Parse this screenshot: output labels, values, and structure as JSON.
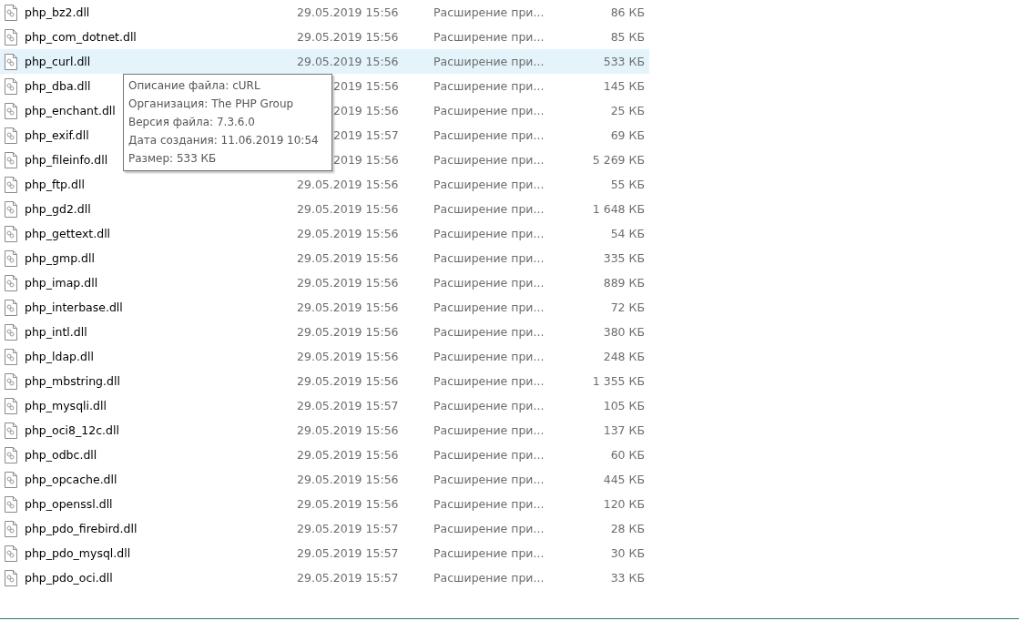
{
  "files": [
    {
      "name": "php_bz2.dll",
      "date": "29.05.2019 15:56",
      "type": "Расширение при...",
      "size": "86 КБ",
      "hovered": false
    },
    {
      "name": "php_com_dotnet.dll",
      "date": "29.05.2019 15:56",
      "type": "Расширение при...",
      "size": "85 КБ",
      "hovered": false
    },
    {
      "name": "php_curl.dll",
      "date": "29.05.2019 15:56",
      "type": "Расширение при...",
      "size": "533 КБ",
      "hovered": true
    },
    {
      "name": "php_dba.dll",
      "date": "2019 15:56",
      "date_clipped": true,
      "type": "Расширение при...",
      "size": "145 КБ",
      "hovered": false
    },
    {
      "name": "php_enchant.dll",
      "date": "2019 15:56",
      "date_clipped": true,
      "type": "Расширение при...",
      "size": "25 КБ",
      "hovered": false
    },
    {
      "name": "php_exif.dll",
      "date": "2019 15:57",
      "date_clipped": true,
      "type": "Расширение при...",
      "size": "69 КБ",
      "hovered": false
    },
    {
      "name": "php_fileinfo.dll",
      "date": "2019 15:56",
      "date_clipped": true,
      "type": "Расширение при...",
      "size": "5 269 КБ",
      "hovered": false
    },
    {
      "name": "php_ftp.dll",
      "date": "29.05.2019 15:56",
      "type": "Расширение при...",
      "size": "55 КБ",
      "hovered": false
    },
    {
      "name": "php_gd2.dll",
      "date": "29.05.2019 15:56",
      "type": "Расширение при...",
      "size": "1 648 КБ",
      "hovered": false
    },
    {
      "name": "php_gettext.dll",
      "date": "29.05.2019 15:56",
      "type": "Расширение при...",
      "size": "54 КБ",
      "hovered": false
    },
    {
      "name": "php_gmp.dll",
      "date": "29.05.2019 15:56",
      "type": "Расширение при...",
      "size": "335 КБ",
      "hovered": false
    },
    {
      "name": "php_imap.dll",
      "date": "29.05.2019 15:56",
      "type": "Расширение при...",
      "size": "889 КБ",
      "hovered": false
    },
    {
      "name": "php_interbase.dll",
      "date": "29.05.2019 15:56",
      "type": "Расширение при...",
      "size": "72 КБ",
      "hovered": false
    },
    {
      "name": "php_intl.dll",
      "date": "29.05.2019 15:56",
      "type": "Расширение при...",
      "size": "380 КБ",
      "hovered": false
    },
    {
      "name": "php_ldap.dll",
      "date": "29.05.2019 15:56",
      "type": "Расширение при...",
      "size": "248 КБ",
      "hovered": false
    },
    {
      "name": "php_mbstring.dll",
      "date": "29.05.2019 15:56",
      "type": "Расширение при...",
      "size": "1 355 КБ",
      "hovered": false
    },
    {
      "name": "php_mysqli.dll",
      "date": "29.05.2019 15:57",
      "type": "Расширение при...",
      "size": "105 КБ",
      "hovered": false
    },
    {
      "name": "php_oci8_12c.dll",
      "date": "29.05.2019 15:56",
      "type": "Расширение при...",
      "size": "137 КБ",
      "hovered": false
    },
    {
      "name": "php_odbc.dll",
      "date": "29.05.2019 15:56",
      "type": "Расширение при...",
      "size": "60 КБ",
      "hovered": false
    },
    {
      "name": "php_opcache.dll",
      "date": "29.05.2019 15:56",
      "type": "Расширение при...",
      "size": "445 КБ",
      "hovered": false
    },
    {
      "name": "php_openssl.dll",
      "date": "29.05.2019 15:56",
      "type": "Расширение при...",
      "size": "120 КБ",
      "hovered": false
    },
    {
      "name": "php_pdo_firebird.dll",
      "date": "29.05.2019 15:57",
      "type": "Расширение при...",
      "size": "28 КБ",
      "hovered": false
    },
    {
      "name": "php_pdo_mysql.dll",
      "date": "29.05.2019 15:57",
      "type": "Расширение при...",
      "size": "30 КБ",
      "hovered": false
    },
    {
      "name": "php_pdo_oci.dll",
      "date": "29.05.2019 15:57",
      "type": "Расширение при...",
      "size": "33 КБ",
      "hovered": false
    }
  ],
  "tooltip": {
    "lines": [
      "Описание файла: cURL",
      "Организация: The PHP Group",
      "Версия файла: 7.3.6.0",
      "Дата создания: 11.06.2019 10:54",
      "Размер: 533 КБ"
    ]
  }
}
